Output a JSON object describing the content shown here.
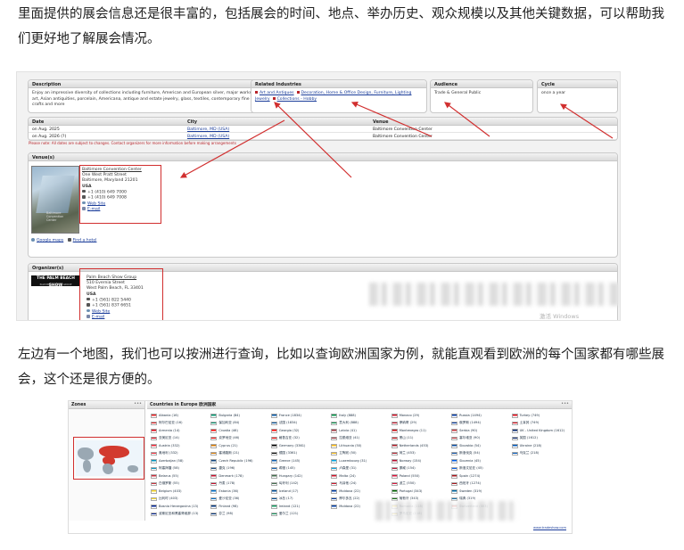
{
  "article": {
    "p1": "里面提供的展会信息还是很丰富的，包括展会的时间、地点、举办历史、观众规模以及其他关键数据，可以帮助我们更好地了解展会情况。",
    "p2": "左边有一个地图，我们也可以按洲进行查询，比如以查询欧洲国家为例，就能直观看到欧洲的每个国家都有哪些展会，这个还是很方便的。"
  },
  "shot1": {
    "description": {
      "title": "Description",
      "text": "Enjoy an impressive diversity of collections including furniture, American and European silver, major works of art, Asian antiquities, porcelain, Americana, antique and estate jewelry, glass, textiles, contemporary fine crafts and more"
    },
    "industries": {
      "title": "Related Industries",
      "items": [
        "Art and Antiques",
        "Decoration, Home & Office Design, Furniture, Lighting",
        "Jewelry",
        "Collections - Hobby"
      ]
    },
    "audience": {
      "title": "Audience",
      "text": "Trade & General Public"
    },
    "cycle": {
      "title": "Cycle",
      "text": "once a year"
    },
    "events": {
      "headers": [
        "Date",
        "City",
        "Venue"
      ],
      "rows": [
        {
          "date": "on Aug. 2025",
          "city": "Baltimore, MD (USA)",
          "venue": "Baltimore Convention Center"
        },
        {
          "date": "on Aug. 2026 (?)",
          "city": "Baltimore, MD (USA)",
          "venue": "Baltimore Convention Center"
        }
      ],
      "note": "Please note: All dates are subject to changes. Contact organizers for more information before making arrangements"
    },
    "venue": {
      "title": "Venue(s)",
      "name": "Baltimore Convention Center",
      "addr1": "One West Pratt Street",
      "addr2": "Baltimore, Maryland 21201",
      "country": "USA",
      "phone1": "+1 (410) 649 7000",
      "phone2": "+1 (410) 649 7008",
      "web": "Web Site",
      "email": "E-mail",
      "map_link": "Google maps",
      "hotel_link": "Find a hotel",
      "image_caption": "Baltimore Convention Center"
    },
    "organizer": {
      "title": "Organizer(s)",
      "logo": "THE PALM BEACH SHOW",
      "logo_sub": "PALM BEACH SHOW GROUP",
      "name": "Palm Beach Show Group",
      "addr1": "510 Evernia Street",
      "addr2": "West Palm Beach, FL 33401",
      "country": "USA",
      "phone1": "+1 (561) 822 5440",
      "phone2": "+1 (561) 837 6651",
      "web": "Web Site",
      "email": "E-mail"
    },
    "watermark": "激活 Windows"
  },
  "shot2": {
    "zones_title": "Zones",
    "countries_title": "Countries in Europe 欧洲国家",
    "footer_link": "www.tradeshow.com",
    "countries": [
      {
        "name": "Albania (16)",
        "flag": "#e41e20"
      },
      {
        "name": "Bulgaria (84)",
        "flag": "#00966e"
      },
      {
        "name": "France (1834)",
        "flag": "#0055a4"
      },
      {
        "name": "Italy (888)",
        "flag": "#009246"
      },
      {
        "name": "Monaco (29)",
        "flag": "#ce1126"
      },
      {
        "name": "Russia (1494)",
        "flag": "#0039a6"
      },
      {
        "name": "Turkey (749)",
        "flag": "#e30a17"
      },
      {
        "name": "阿尔巴尼亚 (16)",
        "flag": "#e41e20"
      },
      {
        "name": "保加利亚 (84)",
        "flag": "#00966e"
      },
      {
        "name": "法国 (1834)",
        "flag": "#0055a4"
      },
      {
        "name": "意大利 (888)",
        "flag": "#009246"
      },
      {
        "name": "摩纳哥 (29)",
        "flag": "#ce1126"
      },
      {
        "name": "俄罗斯 (1494)",
        "flag": "#0039a6"
      },
      {
        "name": "土耳其 (749)",
        "flag": "#e30a17"
      },
      {
        "name": "Armenia (14)",
        "flag": "#d90012"
      },
      {
        "name": "Croatia (46)",
        "flag": "#ff0000"
      },
      {
        "name": "Georgia (32)",
        "flag": "#ff0000"
      },
      {
        "name": "Latvia (41)",
        "flag": "#9e3039"
      },
      {
        "name": "Montenegro (11)",
        "flag": "#c40308"
      },
      {
        "name": "Serbia (90)",
        "flag": "#c6363c"
      },
      {
        "name": "UK - United Kingdom (1612)",
        "flag": "#012169"
      },
      {
        "name": "亚美尼亚 (14)",
        "flag": "#d90012"
      },
      {
        "name": "克罗地亚 (46)",
        "flag": "#ff0000"
      },
      {
        "name": "格鲁吉亚 (32)",
        "flag": "#ff0000"
      },
      {
        "name": "拉脱维亚 (41)",
        "flag": "#9e3039"
      },
      {
        "name": "黑山 (11)",
        "flag": "#c40308"
      },
      {
        "name": "塞尔维亚 (90)",
        "flag": "#c6363c"
      },
      {
        "name": "英国 (1612)",
        "flag": "#012169"
      },
      {
        "name": "Austria (332)",
        "flag": "#ed2939"
      },
      {
        "name": "Cyprus (21)",
        "flag": "#d57800"
      },
      {
        "name": "Germany (3361)",
        "flag": "#000000"
      },
      {
        "name": "Lithuania (50)",
        "flag": "#fdb913"
      },
      {
        "name": "Netherlands (453)",
        "flag": "#ae1c28"
      },
      {
        "name": "Slovakia (54)",
        "flag": "#0b4ea2"
      },
      {
        "name": "Ukraine (218)",
        "flag": "#0057b7"
      },
      {
        "name": "奥地利 (332)",
        "flag": "#ed2939"
      },
      {
        "name": "塞浦路斯 (21)",
        "flag": "#d57800"
      },
      {
        "name": "德国 (3361)",
        "flag": "#000000"
      },
      {
        "name": "立陶宛 (50)",
        "flag": "#fdb913"
      },
      {
        "name": "荷兰 (453)",
        "flag": "#ae1c28"
      },
      {
        "name": "斯洛伐克 (54)",
        "flag": "#0b4ea2"
      },
      {
        "name": "乌克兰 (218)",
        "flag": "#0057b7"
      },
      {
        "name": "Azerbaijan (58)",
        "flag": "#0092bc"
      },
      {
        "name": "Czech Republic (196)",
        "flag": "#11457e"
      },
      {
        "name": "Greece (145)",
        "flag": "#0d5eaf"
      },
      {
        "name": "Luxembourg (31)",
        "flag": "#00a1de"
      },
      {
        "name": "Norway (154)",
        "flag": "#ba0c2f"
      },
      {
        "name": "Slovenia (45)",
        "flag": "#005ce5"
      },
      {
        "name": "",
        "flag": ""
      },
      {
        "name": "阿塞拜疆 (58)",
        "flag": "#0092bc"
      },
      {
        "name": "捷克 (196)",
        "flag": "#11457e"
      },
      {
        "name": "希腊 (145)",
        "flag": "#0d5eaf"
      },
      {
        "name": "卢森堡 (31)",
        "flag": "#00a1de"
      },
      {
        "name": "挪威 (154)",
        "flag": "#ba0c2f"
      },
      {
        "name": "斯洛文尼亚 (45)",
        "flag": "#005ce5"
      },
      {
        "name": "",
        "flag": ""
      },
      {
        "name": "Belarus (55)",
        "flag": "#c8313e"
      },
      {
        "name": "Denmark (178)",
        "flag": "#c8102e"
      },
      {
        "name": "Hungary (142)",
        "flag": "#436f4d"
      },
      {
        "name": "Malta (24)",
        "flag": "#cf142b"
      },
      {
        "name": "Poland (550)",
        "flag": "#dc143c"
      },
      {
        "name": "Spain (1274)",
        "flag": "#aa151b"
      },
      {
        "name": "",
        "flag": ""
      },
      {
        "name": "白俄罗斯 (55)",
        "flag": "#c8313e"
      },
      {
        "name": "丹麦 (178)",
        "flag": "#c8102e"
      },
      {
        "name": "匈牙利 (142)",
        "flag": "#436f4d"
      },
      {
        "name": "马耳他 (24)",
        "flag": "#cf142b"
      },
      {
        "name": "波兰 (550)",
        "flag": "#dc143c"
      },
      {
        "name": "西班牙 (1274)",
        "flag": "#aa151b"
      },
      {
        "name": "",
        "flag": ""
      },
      {
        "name": "Belgium (403)",
        "flag": "#fdda24"
      },
      {
        "name": "Estonia (36)",
        "flag": "#0072ce"
      },
      {
        "name": "Iceland (17)",
        "flag": "#02529c"
      },
      {
        "name": "Moldova (22)",
        "flag": "#003da5"
      },
      {
        "name": "Portugal (343)",
        "flag": "#006600"
      },
      {
        "name": "Sweden (319)",
        "flag": "#006aa7"
      },
      {
        "name": "",
        "flag": ""
      },
      {
        "name": "比利时 (403)",
        "flag": "#fdda24"
      },
      {
        "name": "爱沙尼亚 (36)",
        "flag": "#0072ce"
      },
      {
        "name": "冰岛 (17)",
        "flag": "#02529c"
      },
      {
        "name": "摩尔多瓦 (22)",
        "flag": "#003da5"
      },
      {
        "name": "葡萄牙 (343)",
        "flag": "#006600"
      },
      {
        "name": "瑞典 (319)",
        "flag": "#006aa7"
      },
      {
        "name": "",
        "flag": ""
      },
      {
        "name": "Bosnia Herzegovina (13)",
        "flag": "#002395"
      },
      {
        "name": "Finland (98)",
        "flag": "#003580"
      },
      {
        "name": "Ireland (121)",
        "flag": "#169b62"
      },
      {
        "name": "Moldova (22)",
        "flag": "#003da5"
      },
      {
        "name": "Romania (118)",
        "flag": "#fcd116"
      },
      {
        "name": "Switzerland (403)",
        "flag": "#d52b1e"
      },
      {
        "name": "",
        "flag": ""
      },
      {
        "name": "波斯尼亚和黑塞哥维那 (13)",
        "flag": "#002395"
      },
      {
        "name": "芬兰 (98)",
        "flag": "#003580"
      },
      {
        "name": "爱尔兰 (121)",
        "flag": "#169b62"
      },
      {
        "name": "",
        "flag": ""
      },
      {
        "name": "罗马尼亚 (118)",
        "flag": "#fcd116"
      },
      {
        "name": "",
        "flag": ""
      },
      {
        "name": "",
        "flag": ""
      }
    ]
  }
}
